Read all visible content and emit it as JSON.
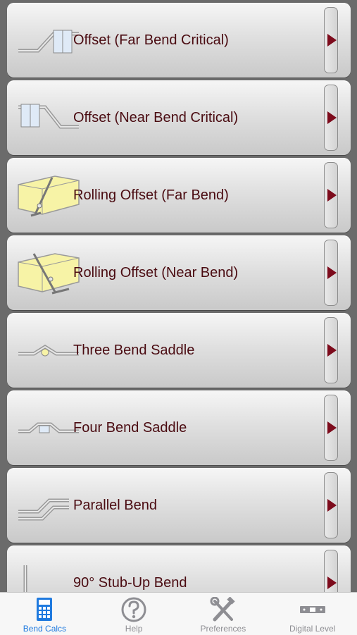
{
  "list": {
    "items": [
      {
        "label": "Offset (Far Bend Critical)",
        "icon": "offset-far-bend-icon"
      },
      {
        "label": "Offset (Near Bend Critical)",
        "icon": "offset-near-bend-icon"
      },
      {
        "label": "Rolling Offset (Far Bend)",
        "icon": "rolling-offset-far-icon"
      },
      {
        "label": "Rolling Offset (Near Bend)",
        "icon": "rolling-offset-near-icon"
      },
      {
        "label": "Three Bend Saddle",
        "icon": "three-bend-saddle-icon"
      },
      {
        "label": "Four Bend Saddle",
        "icon": "four-bend-saddle-icon"
      },
      {
        "label": "Parallel Bend",
        "icon": "parallel-bend-icon"
      },
      {
        "label": "90° Stub-Up Bend",
        "icon": "stub-up-bend-icon"
      }
    ]
  },
  "tabbar": {
    "tabs": [
      {
        "label": "Bend Calcs",
        "icon": "calculator-icon",
        "active": true
      },
      {
        "label": "Help",
        "icon": "help-icon",
        "active": false
      },
      {
        "label": "Preferences",
        "icon": "tools-icon",
        "active": false
      },
      {
        "label": "Digital Level",
        "icon": "level-icon",
        "active": false
      }
    ]
  },
  "colors": {
    "label_text": "#4a0b11",
    "disclosure_arrow": "#7d0b1c",
    "active_tab": "#1f7adf",
    "inactive_tab": "#8e8e93",
    "background": "#6b6b6b"
  }
}
